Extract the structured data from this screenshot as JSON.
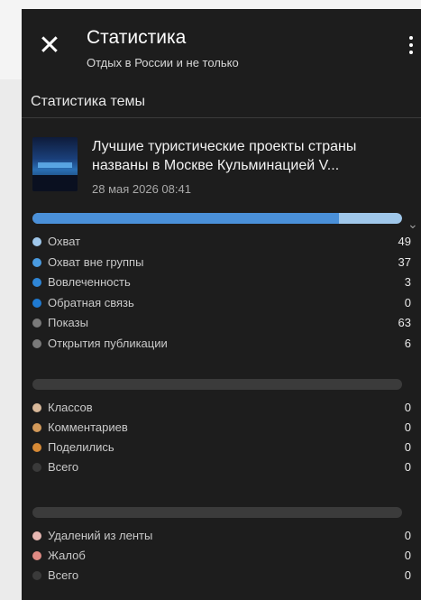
{
  "header": {
    "title": "Статистика",
    "subtitle": "Отдых в России и не только"
  },
  "section_title": "Статистика темы",
  "post": {
    "title": "Лучшие туристические проекты страны названы в Москве Кульминацией V...",
    "date": "28 мая 2026 08:41"
  },
  "reach": {
    "bar_fill_fraction": 1.0,
    "bar_segment_fraction": 0.83,
    "colors": {
      "segment": "#4a90d9",
      "rest": "#9fc7ea"
    },
    "items": [
      {
        "label": "Охват",
        "value": "49",
        "color": "#9fc7ea"
      },
      {
        "label": "Охват вне группы",
        "value": "37",
        "color": "#4a9be0"
      },
      {
        "label": "Вовлеченность",
        "value": "3",
        "color": "#2f86d6"
      },
      {
        "label": "Обратная связь",
        "value": "0",
        "color": "#1f7ad1"
      },
      {
        "label": "Показы",
        "value": "63",
        "color": "#7a7a7a"
      },
      {
        "label": "Открытия публикации",
        "value": "6",
        "color": "#7a7a7a"
      }
    ]
  },
  "interactions": {
    "items": [
      {
        "label": "Классов",
        "value": "0",
        "color": "#d9b99a"
      },
      {
        "label": "Комментариев",
        "value": "0",
        "color": "#d39a5a"
      },
      {
        "label": "Поделились",
        "value": "0",
        "color": "#d78a36"
      },
      {
        "label": "Всего",
        "value": "0",
        "color": "#3a3a3a"
      }
    ]
  },
  "negative": {
    "items": [
      {
        "label": "Удалений из ленты",
        "value": "0",
        "color": "#e7b8b3"
      },
      {
        "label": "Жалоб",
        "value": "0",
        "color": "#e08b84"
      },
      {
        "label": "Всего",
        "value": "0",
        "color": "#3a3a3a"
      }
    ]
  }
}
